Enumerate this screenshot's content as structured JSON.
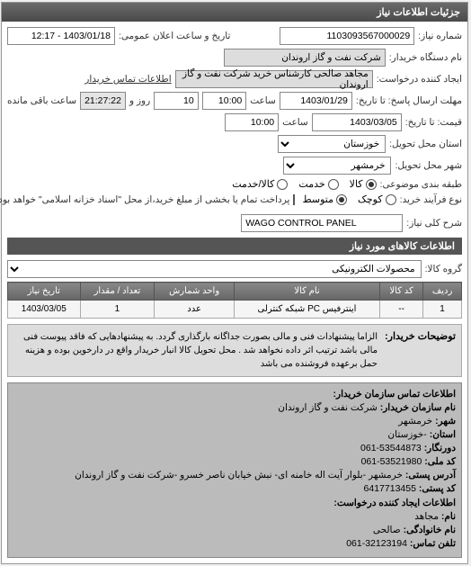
{
  "panel_title": "جزئیات اطلاعات نیاز",
  "labels": {
    "request_no": "شماره نیاز:",
    "public_datetime": "تاریخ و ساعت اعلان عمومی:",
    "buyer_device": "نام دستگاه خریدار:",
    "request_creator": "ایجاد کننده درخواست:",
    "buyer_contact_info": "اطلاعات تماس خریدار",
    "reply_deadline": "مهلت ارسال پاسخ: تا تاریخ:",
    "hour": "ساعت",
    "day": "روز و",
    "remaining": "ساعت باقی مانده",
    "price_until": "قیمت: تا تاریخ:",
    "delivery_province": "استان محل تحویل:",
    "delivery_city": "شهر محل تحویل:",
    "subject_category": "طبقه بندی موضوعی:",
    "process_type": "نوع فرآیند خرید:",
    "goods": "کالا",
    "service": "خدمت",
    "goods_service": "کالا/خدمت",
    "small": "کوچک",
    "medium": "متوسط",
    "payment_note": "پرداخت تمام یا بخشی از مبلغ خرید،از محل \"اسناد خزانه اسلامی\" خواهد بود.",
    "need_desc": "شرح کلی نیاز:",
    "goods_info_title": "اطلاعات کالاهای مورد نیاز",
    "goods_group": "گروه کالا:",
    "notes_label": "توضیحات خریدار:",
    "contact_header": "اطلاعات تماس سازمان خریدار:",
    "org_name": "نام سازمان خریدار:",
    "city": "شهر:",
    "province": "استان:",
    "fax": "دورنگار:",
    "national_id": "کد ملی:",
    "postal_addr": "آدرس پستی:",
    "postal_code": "کد پستی:",
    "creator_info": "اطلاعات ایجاد کننده درخواست:",
    "name": "نام:",
    "family": "نام خانوادگی:",
    "phone": "تلفن تماس:"
  },
  "values": {
    "request_no": "1103093567000029",
    "public_datetime": "1403/01/18 - 12:17",
    "buyer_device": "شرکت نفت و گاز اروندان",
    "request_creator": "مجاهد صالحی کارشناس خرید شرکت نفت و گاز اروندان",
    "reply_date": "1403/01/29",
    "reply_time": "10:00",
    "remaining_days": "10",
    "remaining_time": "21:27:22",
    "price_date": "1403/03/05",
    "price_time": "10:00",
    "province": "خوزستان",
    "city": "خرمشهر",
    "subject_selected": "goods",
    "process_selected": "medium",
    "need_desc": "WAGO CONTROL PANEL",
    "goods_group": "محصولات الکترونیکی",
    "notes": "الزاما پیشنهادات فنی و مالی بصورت جداگانه بارگذاری گردد. به پیشنهادهایی که فاقد پیوست فنی مالی باشد ترتیب اثر داده نخواهد شد . محل تحویل کالا انبار خریدار واقع در دارخوین بوده و هزینه حمل برعهده فروشنده می باشد"
  },
  "table": {
    "headers": [
      "ردیف",
      "کد کالا",
      "نام کالا",
      "واحد شمارش",
      "تعداد / مقدار",
      "تاریخ نیاز"
    ],
    "row": {
      "index": "1",
      "code": "--",
      "name": "اینترفیس PC شبکه کنترلی",
      "unit": "عدد",
      "qty": "1",
      "date": "1403/03/05"
    }
  },
  "contact": {
    "org_name": "شرکت نفت و گاز اروندان",
    "city": "خرمشهر",
    "province": "-خوزستان",
    "fax": "061-53544873",
    "national_id": "061-53521980",
    "postal_addr": "خرمشهر -بلوار آیت اله خامنه ای- نبش خیابان ناصر خسرو -شرکت نفت و گاز اروندان",
    "postal_code": "6417713455",
    "name": "مجاهد",
    "family": "صالحی",
    "phone": "061-32123194"
  }
}
